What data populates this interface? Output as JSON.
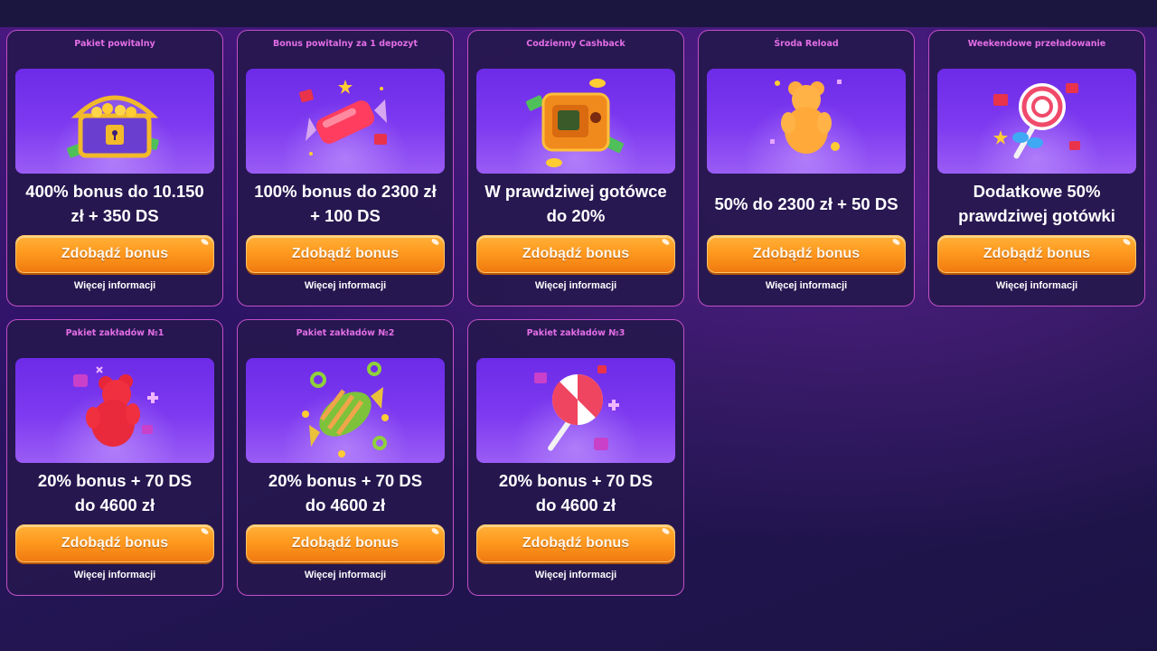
{
  "cards": [
    {
      "label": "Pakiet powitalny",
      "offer_line1": "400% bonus do 10.150",
      "offer_line2": "zł + 350 DS",
      "icon": "treasure-chest-icon"
    },
    {
      "label": "Bonus powitalny za 1 depozyt",
      "offer_line1": "100% bonus do 2300 zł",
      "offer_line2": "+ 100 DS",
      "icon": "candy-icon"
    },
    {
      "label": "Codzienny Cashback",
      "offer_line1": "W prawdziwej gotówce",
      "offer_line2": "do 20%",
      "icon": "safe-icon"
    },
    {
      "label": "Środa Reload",
      "offer_line1": "50% do 2300 zł + 50 DS",
      "offer_line2": "",
      "icon": "gummy-bear-icon"
    },
    {
      "label": "Weekendowe przeładowanie",
      "offer_line1": "Dodatkowe 50%",
      "offer_line2": "prawdziwej gotówki",
      "icon": "lollipop-icon"
    },
    {
      "label": "Pakiet zakładów №1",
      "offer_line1": "20% bonus + 70 DS",
      "offer_line2": "do 4600 zł",
      "icon": "gummy-bear-icon"
    },
    {
      "label": "Pakiet zakładów №2",
      "offer_line1": "20% bonus + 70 DS",
      "offer_line2": "do 4600 zł",
      "icon": "candy-icon"
    },
    {
      "label": "Pakiet zakładów №3",
      "offer_line1": "20% bonus + 70 DS",
      "offer_line2": "do 4600 zł",
      "icon": "lollipop-icon"
    }
  ],
  "button_label": "Zdobądź bonus",
  "more_label": "Więcej informacji",
  "colors": {
    "card_border": "#c24fc8",
    "label": "#e36ee6",
    "button": "#ff9a1f",
    "banner": "#7e3af0"
  }
}
